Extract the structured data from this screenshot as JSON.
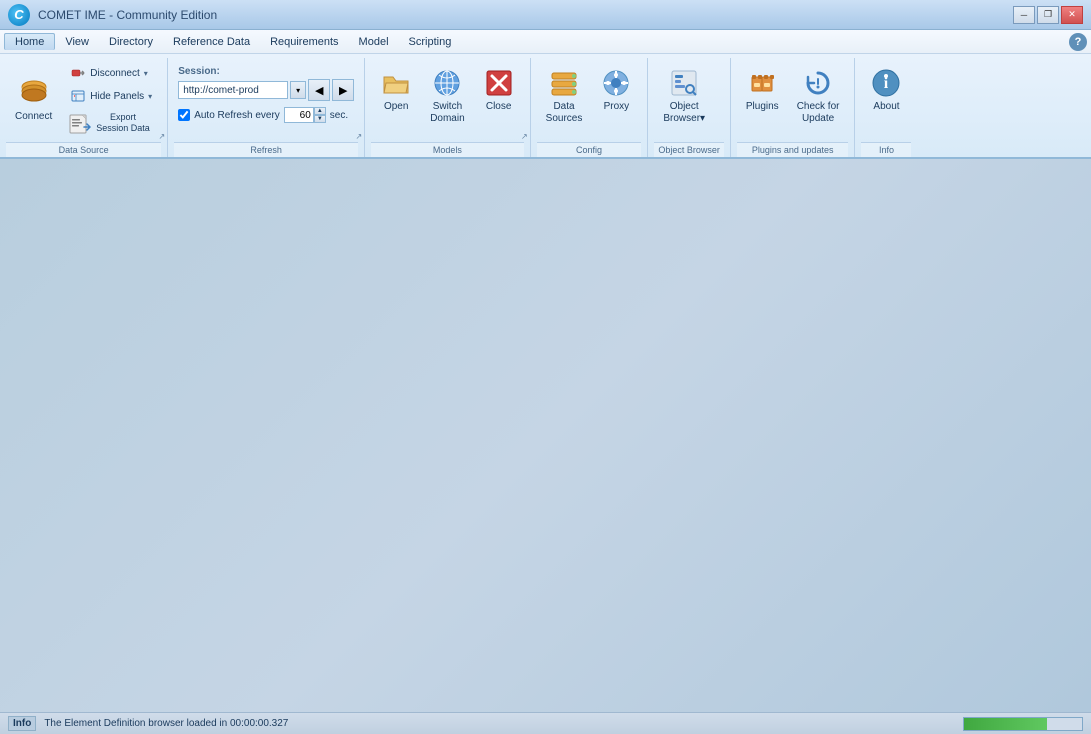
{
  "titleBar": {
    "title": "COMET IME - Community Edition",
    "icon": "C",
    "controls": {
      "minimize": "─",
      "restore": "❐",
      "close": "✕"
    }
  },
  "menuBar": {
    "items": [
      {
        "id": "home",
        "label": "Home",
        "active": true
      },
      {
        "id": "view",
        "label": "View"
      },
      {
        "id": "directory",
        "label": "Directory"
      },
      {
        "id": "reference-data",
        "label": "Reference Data"
      },
      {
        "id": "requirements",
        "label": "Requirements"
      },
      {
        "id": "model",
        "label": "Model"
      },
      {
        "id": "scripting",
        "label": "Scripting"
      }
    ]
  },
  "ribbon": {
    "groups": {
      "dataSource": {
        "label": "Data Source",
        "connectLabel": "Connect",
        "disconnectLabel": "Disconnect",
        "hidePanelsLabel": "Hide Panels",
        "exportSessionLabel": "Export\nSession Data"
      },
      "refresh": {
        "label": "Refresh",
        "sessionLabel": "Session:",
        "sessionValue": "http://comet-prod",
        "autoRefreshLabel": "Auto Refresh every",
        "autoRefreshValue": "60",
        "secLabel": "sec."
      },
      "models": {
        "label": "Models",
        "openLabel": "Open",
        "switchDomainLabel": "Switch\nDomain",
        "closeLabel": "Close"
      },
      "config": {
        "label": "Config",
        "dataSourcesLabel": "Data\nSources",
        "proxyLabel": "Proxy"
      },
      "objectBrowser": {
        "label": "Object Browser",
        "objectBrowserLabel": "Object\nBrowser▾"
      },
      "pluginsAndUpdates": {
        "label": "Plugins and updates",
        "pluginsLabel": "Plugins",
        "checkForUpdateLabel": "Check for\nUpdate"
      },
      "info": {
        "label": "Info",
        "aboutLabel": "About"
      }
    }
  },
  "statusBar": {
    "infoLabel": "Info",
    "message": "The Element Definition browser loaded in 00:00:00.327",
    "progressValue": 70
  }
}
